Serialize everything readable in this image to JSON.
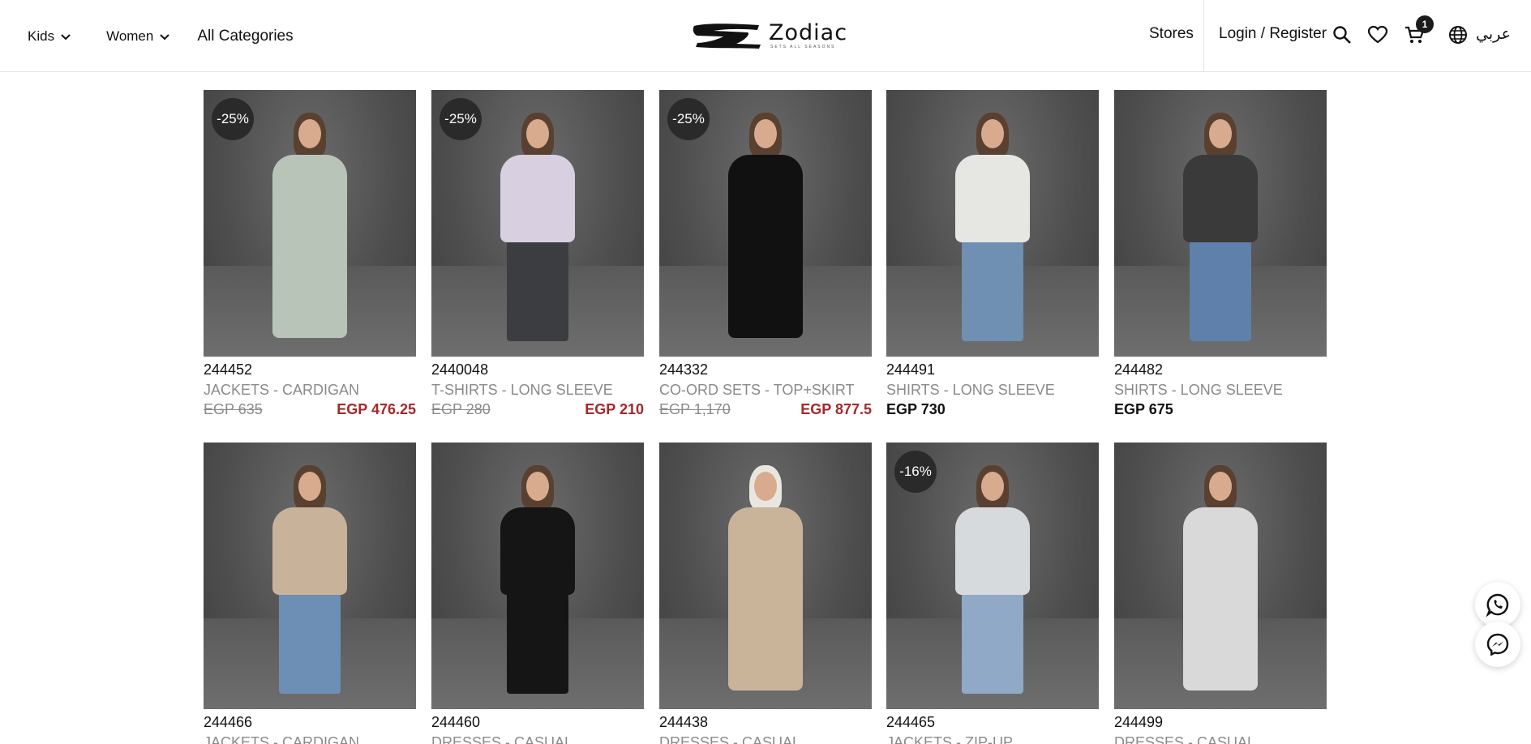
{
  "header": {
    "nav": {
      "kids": "Kids",
      "women": "Women",
      "all_categories": "All Categories"
    },
    "logo": {
      "brand": "Zodiac",
      "tagline": "SETS ALL SEASONS"
    },
    "stores": "Stores",
    "login_register": "Login / Register",
    "cart_count": "1",
    "language": "عربي",
    "icons": [
      "search-icon",
      "heart-icon",
      "cart-icon",
      "globe-icon"
    ]
  },
  "products": [
    {
      "badge": "-25%",
      "sku": "244452",
      "category": "JACKETS - CARDIGAN",
      "old_price": "EGP 635",
      "price": "EGP 476.25",
      "on_sale": true
    },
    {
      "badge": "-25%",
      "sku": "2440048",
      "category": "T-SHIRTS - LONG SLEEVE",
      "old_price": "EGP 280",
      "price": "EGP 210",
      "on_sale": true
    },
    {
      "badge": "-25%",
      "sku": "244332",
      "category": "CO-ORD SETS - TOP+SKIRT",
      "old_price": "EGP 1,170",
      "price": "EGP 877.5",
      "on_sale": true
    },
    {
      "badge": "",
      "sku": "244491",
      "category": "SHIRTS - LONG SLEEVE",
      "old_price": "",
      "price": "EGP 730",
      "on_sale": false
    },
    {
      "badge": "",
      "sku": "244482",
      "category": "SHIRTS - LONG SLEEVE",
      "old_price": "",
      "price": "EGP 675",
      "on_sale": false
    },
    {
      "badge": "",
      "sku": "244466",
      "category": "JACKETS - CARDIGAN",
      "old_price": "",
      "price": "",
      "on_sale": false
    },
    {
      "badge": "",
      "sku": "244460",
      "category": "DRESSES - CASUAL",
      "old_price": "",
      "price": "",
      "on_sale": false
    },
    {
      "badge": "",
      "sku": "244438",
      "category": "DRESSES - CASUAL",
      "old_price": "",
      "price": "",
      "on_sale": false
    },
    {
      "badge": "-16%",
      "sku": "244465",
      "category": "JACKETS - ZIP-UP",
      "old_price": "",
      "price": "",
      "on_sale": false
    },
    {
      "badge": "",
      "sku": "244499",
      "category": "DRESSES - CASUAL",
      "old_price": "",
      "price": "",
      "on_sale": false
    }
  ],
  "floating": [
    "whatsapp-icon",
    "messenger-icon"
  ],
  "colors": {
    "sale_price": "#a32929",
    "muted": "#8a8a8a",
    "badge_bg": "#2a2a2a"
  }
}
